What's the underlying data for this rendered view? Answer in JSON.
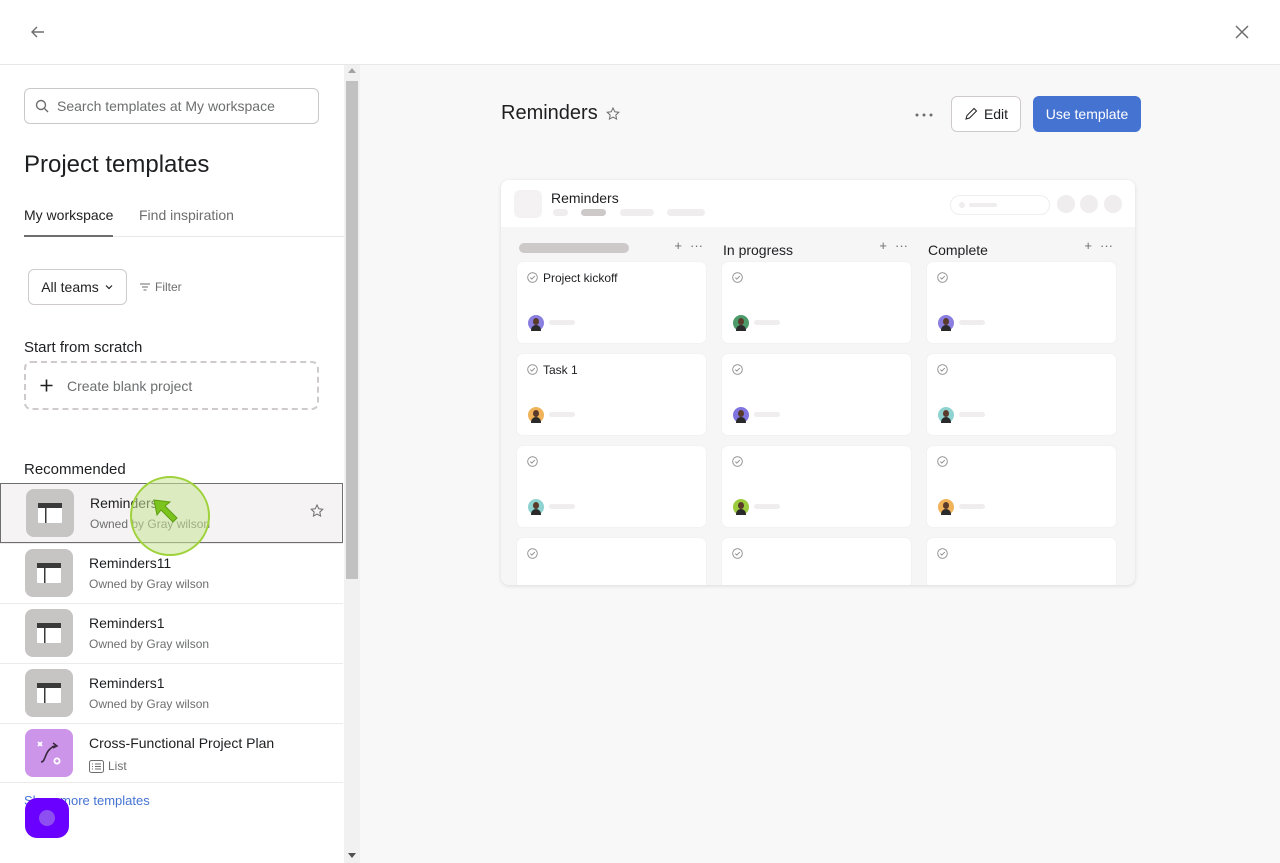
{
  "topbar": {
    "back_icon": "arrow-left-icon",
    "close_icon": "close-icon"
  },
  "sidebar": {
    "search": {
      "placeholder": "Search templates at My workspace",
      "value": ""
    },
    "title": "Project templates",
    "tabs": [
      {
        "label": "My workspace",
        "active": true
      },
      {
        "label": "Find inspiration",
        "active": false
      }
    ],
    "teams_dropdown": {
      "selected": "All teams"
    },
    "filter_label": "Filter",
    "scratch_heading": "Start from scratch",
    "blank_project_label": "Create blank project",
    "recommended_heading": "Recommended",
    "templates": [
      {
        "name": "Reminders",
        "subtitle": "Owned by Gray wilson",
        "icon": "board-icon",
        "selected": true
      },
      {
        "name": "Reminders11",
        "subtitle": "Owned by Gray wilson",
        "icon": "board-icon",
        "selected": false
      },
      {
        "name": "Reminders1",
        "subtitle": "Owned by Gray wilson",
        "icon": "board-icon",
        "selected": false
      },
      {
        "name": "Reminders1",
        "subtitle": "Owned by Gray wilson",
        "icon": "board-icon",
        "selected": false
      },
      {
        "name": "Cross-Functional Project Plan",
        "subtitle": "List",
        "icon": "workflow-icon",
        "selected": false
      }
    ],
    "show_more_label": "Show more templates"
  },
  "preview": {
    "title": "Reminders",
    "edit_label": "Edit",
    "use_template_label": "Use template",
    "card": {
      "project_name": "Reminders",
      "columns": [
        {
          "title": "",
          "tasks": [
            {
              "name": "Project kickoff",
              "avatar_color": "#8a7fe0"
            },
            {
              "name": "Task 1",
              "avatar_color": "#f0b35a"
            },
            {
              "name": "",
              "avatar_color": "#8fd3d0"
            },
            {
              "name": "",
              "avatar_color": ""
            }
          ]
        },
        {
          "title": "In progress",
          "tasks": [
            {
              "name": "",
              "avatar_color": "#4c9a6a"
            },
            {
              "name": "",
              "avatar_color": "#7f74e0"
            },
            {
              "name": "",
              "avatar_color": "#9ccc3e"
            },
            {
              "name": "",
              "avatar_color": ""
            }
          ]
        },
        {
          "title": "Complete",
          "tasks": [
            {
              "name": "",
              "avatar_color": "#8a7fe0"
            },
            {
              "name": "",
              "avatar_color": "#8fd3d0"
            },
            {
              "name": "",
              "avatar_color": "#f0b35a"
            },
            {
              "name": "",
              "avatar_color": ""
            }
          ]
        }
      ]
    }
  },
  "colors": {
    "accent": "#4573d2",
    "selected_border": "#6d6e6f",
    "help_bubble": "#6a00ff",
    "workflow_icon_bg": "#cd95ea"
  }
}
